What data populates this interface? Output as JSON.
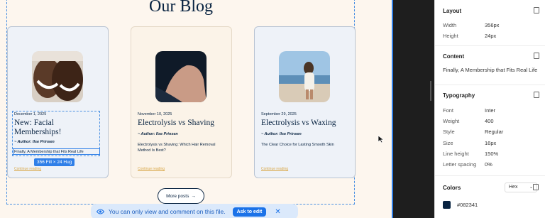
{
  "blog": {
    "title": "Our Blog",
    "more_label": "More posts",
    "more_icon": "→",
    "cards": [
      {
        "date": "December 1, 2025",
        "title": "New: Facial Memberships!",
        "author": "~ Author: Ilse Prinsen",
        "excerpt": "Finally, A Membership that Fits Real Life",
        "continue": "Continue reading"
      },
      {
        "date": "November 10, 2025",
        "title": "Electrolysis vs Shaving",
        "author": "~ Author: Ilse Prinsen",
        "excerpt": "Electrolysis vs Shaving: Which Hair Removal Method Is Best?",
        "continue": "Continue reading"
      },
      {
        "date": "September 29, 2025",
        "title": "Electrolysis vs Waxing",
        "author": "~ Author: Ilse Prinsen",
        "excerpt": "The Clear Choice for Lasting Smooth Skin",
        "continue": "Continue reading"
      }
    ]
  },
  "selection": {
    "size_label": "356 Fill × 24 Hug"
  },
  "toast": {
    "message": "You can only view and comment on this file.",
    "button": "Ask to edit",
    "close": "✕",
    "icon": "eye-icon"
  },
  "panel": {
    "layout": {
      "heading": "Layout",
      "width_label": "Width",
      "width_value": "356px",
      "height_label": "Height",
      "height_value": "24px"
    },
    "content": {
      "heading": "Content",
      "text": "Finally, A Membership that Fits Real Life"
    },
    "typography": {
      "heading": "Typography",
      "rows": [
        {
          "label": "Font",
          "value": "Inter"
        },
        {
          "label": "Weight",
          "value": "400"
        },
        {
          "label": "Style",
          "value": "Regular"
        },
        {
          "label": "Size",
          "value": "16px"
        },
        {
          "label": "Line height",
          "value": "150%"
        },
        {
          "label": "Letter spacing",
          "value": "0%"
        }
      ]
    },
    "colors": {
      "heading": "Colors",
      "format": "Hex",
      "value": "#082341"
    }
  },
  "colors": {
    "navy": "#082341",
    "accent": "#2f7fe8",
    "link": "#d9a84a"
  }
}
